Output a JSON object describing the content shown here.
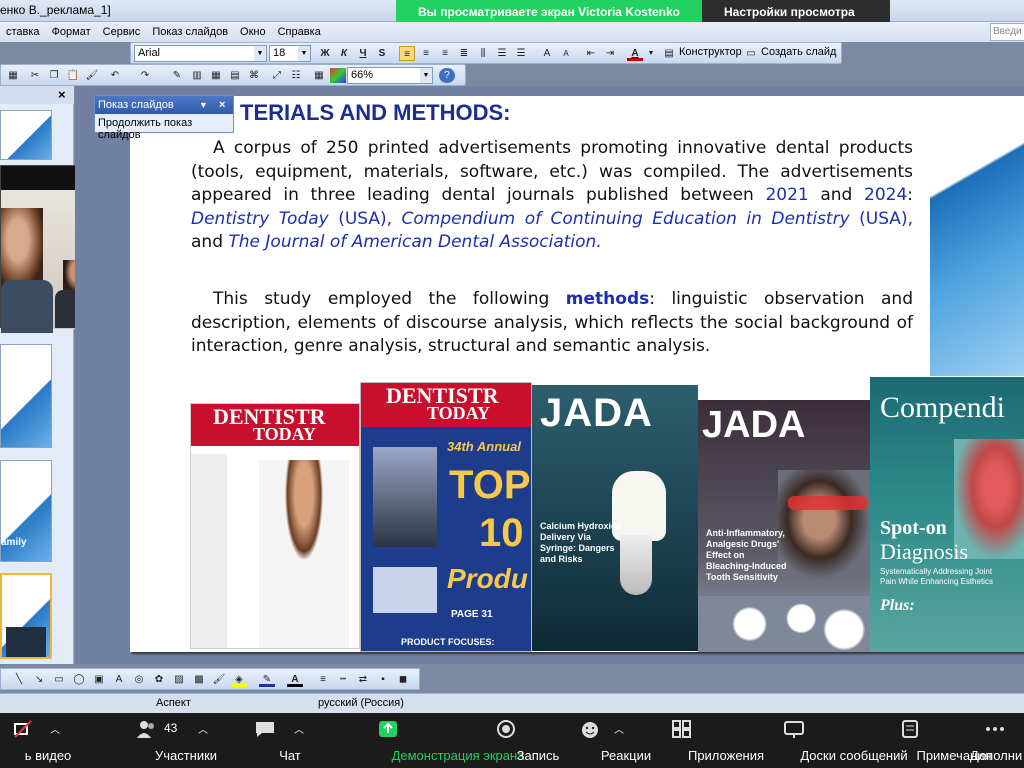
{
  "window": {
    "title": "енко В._реклама_1]"
  },
  "zoom_banner": {
    "sharing_text": "Вы просматриваете экран Victoria Kostenko",
    "view_settings": "Настройки просмотра",
    "chevron": "⌄"
  },
  "menubar": {
    "items": [
      "ставка",
      "Формат",
      "Сервис",
      "Показ слайдов",
      "Окно",
      "Справка"
    ]
  },
  "search": {
    "placeholder": "Введи"
  },
  "toolbar_format": {
    "font": "Arial",
    "size": "18",
    "bold": "Ж",
    "italic": "К",
    "underline": "Ч",
    "shadow": "S",
    "designer": "Конструктор",
    "new_slide": "Создать слайд"
  },
  "toolbar_standard": {
    "zoom": "66%"
  },
  "slideshow_popup": {
    "title": "Показ слайдов",
    "close": "×",
    "action": "Продолжить показ слайдов"
  },
  "thumbnails": {
    "label_1": "amily"
  },
  "slide": {
    "title": "TERIALS AND METHODS:",
    "p1_a": "A corpus of ",
    "p1_num": "250",
    "p1_b": " printed advertisements promoting innovative dental products (tools, equipment, materials, software, etc.) was compiled. The advertisements appeared in three leading dental journals published between ",
    "p1_y1": "2021",
    "p1_and": " and ",
    "p1_y2": "2024",
    "p1_colon": ": ",
    "p1_j1": "Dentistry Today",
    "p1_usa1": " (USA), ",
    "p1_j2": "Compendium of Continuing Education in Dentistry",
    "p1_usa2": " (USA), ",
    "p1_and2": "and ",
    "p1_j3": "The Journal of American Dental Association.",
    "p2_a": "This study employed the following ",
    "p2_methods": "methods",
    "p2_b": ": linguistic observation and description, elements of discourse analysis, which reflects the social background of interaction, genre analysis, structural and semantic analysis."
  },
  "magazines": {
    "dt1_title": "DENTISTR",
    "dt1_sub": "TODAY",
    "dt2_title": "DENTISTR",
    "dt2_sub": "TODAY",
    "dt2_annual": "34th Annual",
    "dt2_top": "TOP",
    "dt2_num": "10",
    "dt2_prod": "Produ",
    "dt2_page": "PAGE 31",
    "dt2_focus": "PRODUCT FOCUSES:",
    "jada1_logo": "JADA",
    "jada1_head": "Calcium Hydroxide Delivery Via Syringe: Dangers and Risks",
    "jada2_logo": "JADA",
    "jada2_head": "Anti-Inflammatory, Analgesic Drugs' Effect on Bleaching-Induced Tooth Sensitivity",
    "comp_logo": "Compendi",
    "comp_spot": "Spot-on",
    "comp_diag": "Diagnosis",
    "comp_desc": "Systematically Addressing Joint Pain While Enhancing Esthetics",
    "comp_plus": "Plus:"
  },
  "statusbar": {
    "design": "Аспект",
    "language": "русский (Россия)"
  },
  "zoom_controls": {
    "video": "ь видео",
    "participants": "Участники",
    "participants_count": "43",
    "chat": "Чат",
    "share": "Демонстрация экрана",
    "record": "Запись",
    "reactions": "Реакции",
    "apps": "Приложения",
    "whiteboards": "Доски сообщений",
    "notes": "Примечания",
    "more": "Дополни",
    "share_color": "#23d160"
  }
}
